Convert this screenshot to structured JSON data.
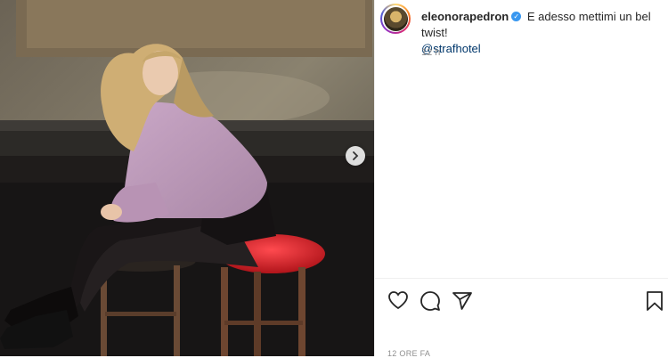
{
  "post": {
    "username": "eleonorapedron",
    "verified_symbol": "✓",
    "caption": "E adesso mettimi un bel twist!",
    "mention": "@strafhotel",
    "time_short": "12 h",
    "time_long": "12 ORE FA"
  },
  "icons": {
    "like": "heart-icon",
    "comment": "comment-icon",
    "share": "send-icon",
    "save": "bookmark-icon",
    "carousel": "chevron-right-icon"
  },
  "colors": {
    "verified": "#3897f0",
    "mention": "#00376b",
    "muted": "#8e8e8e",
    "stool_red": "#d8232a"
  }
}
